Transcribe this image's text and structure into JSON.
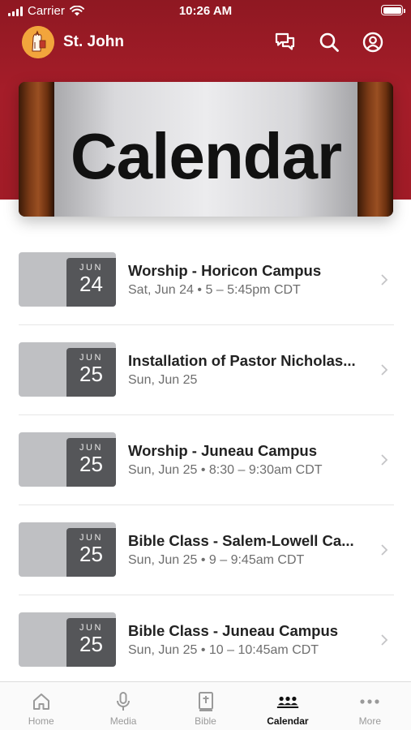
{
  "status_bar": {
    "carrier": "Carrier",
    "time": "10:26 AM"
  },
  "header": {
    "church_name": "St. John"
  },
  "hero": {
    "title": "Calendar"
  },
  "events": [
    {
      "month": "JUN",
      "day": "24",
      "title": "Worship - Horicon Campus",
      "subtitle": "Sat, Jun 24 • 5 – 5:45pm CDT"
    },
    {
      "month": "JUN",
      "day": "25",
      "title": "Installation of Pastor Nicholas...",
      "subtitle": "Sun, Jun 25"
    },
    {
      "month": "JUN",
      "day": "25",
      "title": "Worship - Juneau Campus",
      "subtitle": "Sun, Jun 25 • 8:30 – 9:30am CDT"
    },
    {
      "month": "JUN",
      "day": "25",
      "title": "Bible Class - Salem-Lowell Ca...",
      "subtitle": "Sun, Jun 25 • 9 – 9:45am CDT"
    },
    {
      "month": "JUN",
      "day": "25",
      "title": "Bible Class - Juneau Campus",
      "subtitle": "Sun, Jun 25 • 10 – 10:45am CDT"
    }
  ],
  "tabs": [
    {
      "label": "Home",
      "icon": "home-icon",
      "active": false
    },
    {
      "label": "Media",
      "icon": "microphone-icon",
      "active": false
    },
    {
      "label": "Bible",
      "icon": "bible-icon",
      "active": false
    },
    {
      "label": "Calendar",
      "icon": "people-icon",
      "active": true
    },
    {
      "label": "More",
      "icon": "more-icon",
      "active": false
    }
  ],
  "colors": {
    "brand_red": "#a51d29",
    "badge_gray": "#555659",
    "thumb_gray": "#bfc0c3"
  }
}
